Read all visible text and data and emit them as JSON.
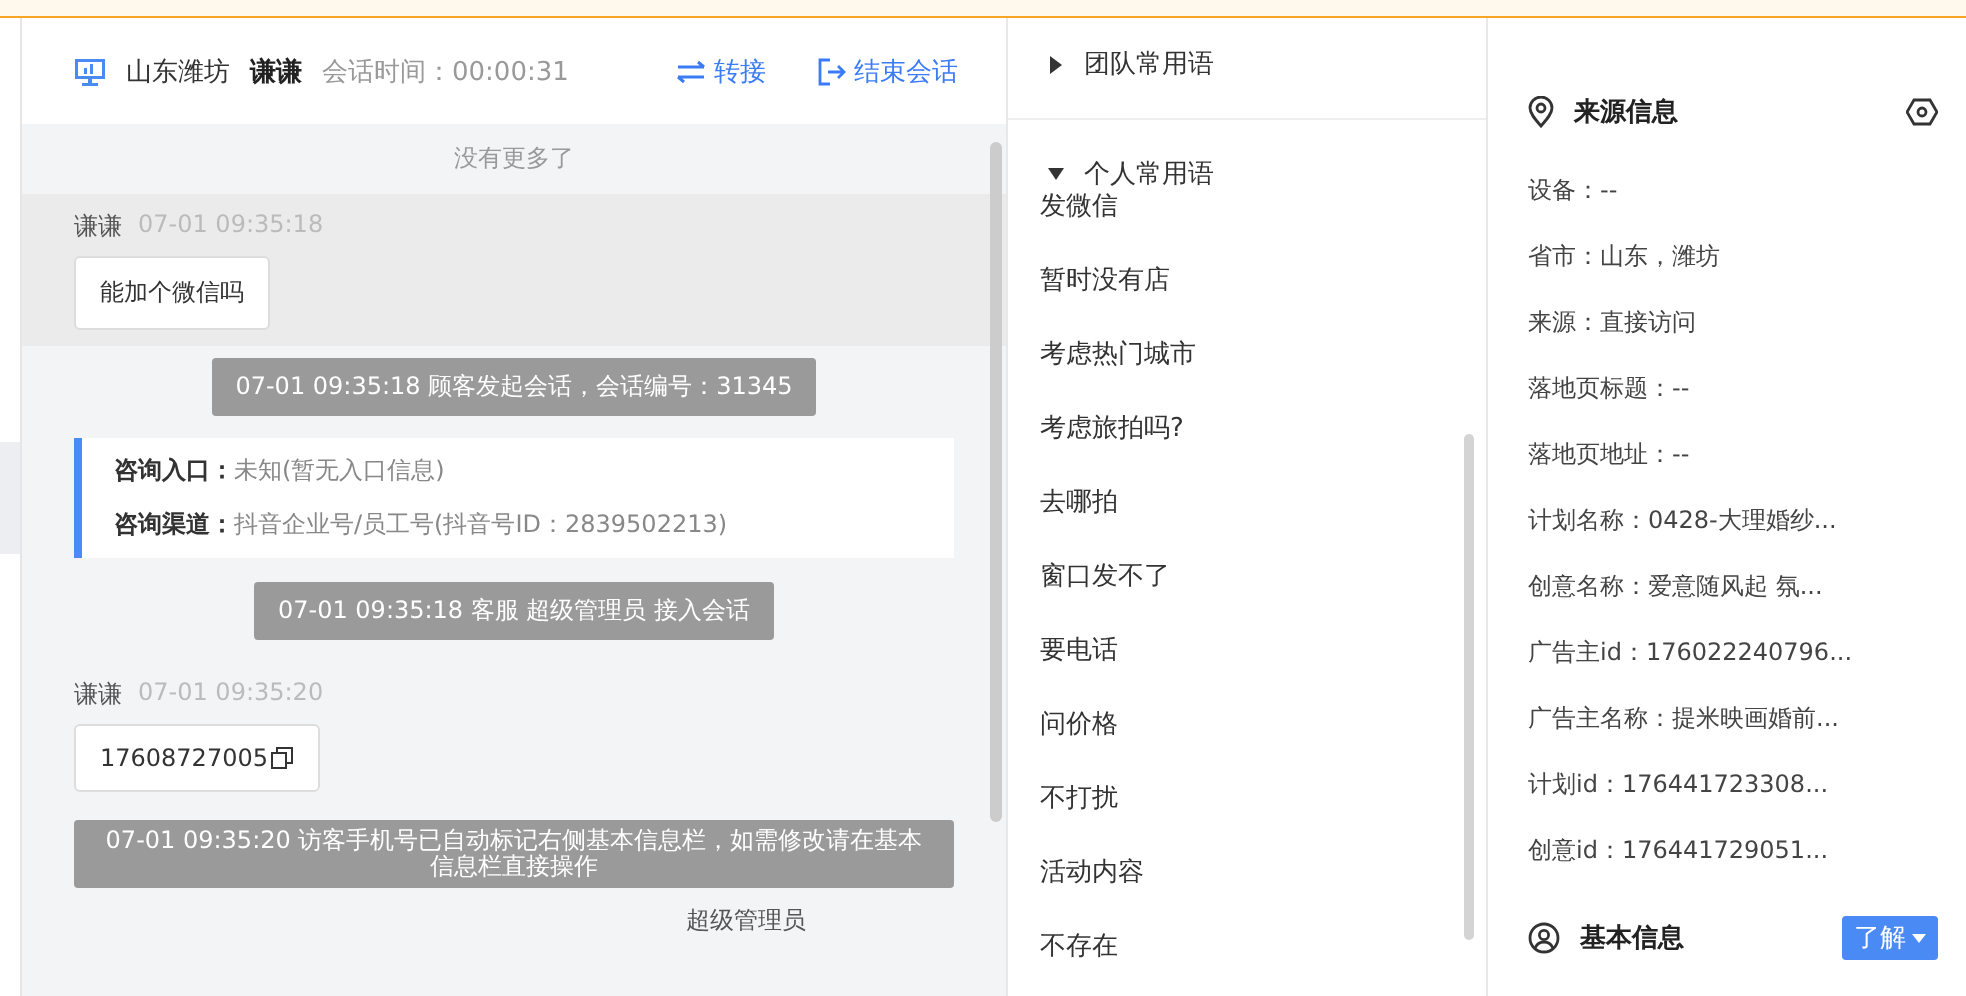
{
  "header": {
    "location": "山东潍坊",
    "visitor": "谦谦",
    "duration_label": "会话时间：",
    "duration": "00:00:31",
    "transfer": "转接",
    "end": "结束会话"
  },
  "chat": {
    "no_more": "没有更多了",
    "messages": [
      {
        "kind": "visitor",
        "name": "谦谦",
        "time": "07-01 09:35:18",
        "text": "能加个微信吗",
        "highlighted": true,
        "copyable": false
      },
      {
        "kind": "notice",
        "text": "07-01 09:35:18 顾客发起会话，会话编号：31345"
      },
      {
        "kind": "info",
        "rows": [
          {
            "label": "咨询入口：",
            "value": "未知(暂无入口信息)"
          },
          {
            "label": "咨询渠道：",
            "value": "抖音企业号/员工号(抖音号ID：2839502213)"
          }
        ]
      },
      {
        "kind": "notice",
        "text": "07-01 09:35:18 客服 超级管理员 接入会话"
      },
      {
        "kind": "visitor",
        "name": "谦谦",
        "time": "07-01 09:35:20",
        "text": "17608727005",
        "highlighted": false,
        "copyable": true
      },
      {
        "kind": "wide-notice",
        "text": "07-01 09:35:20 访客手机号已自动标记右侧基本信息栏，如需修改请在基本信息栏直接操作"
      },
      {
        "kind": "agent",
        "name": "超级管理员"
      }
    ]
  },
  "phrases": {
    "groups": [
      {
        "label": "团队常用语",
        "expanded": false
      },
      {
        "label": "个人常用语",
        "expanded": true,
        "items": [
          "发微信",
          "暂时没有店",
          "考虑热门城市",
          "考虑旅拍吗?",
          "去哪拍",
          "窗口发不了",
          "要电话",
          "问价格",
          "不打扰",
          "活动内容",
          "不存在"
        ]
      }
    ]
  },
  "source": {
    "title": "来源信息",
    "fields": [
      "设备：--",
      "省市：山东，潍坊",
      "来源：直接访问",
      "落地页标题：--",
      "落地页地址：--",
      "计划名称：0428-大理婚纱...",
      "创意名称：爱意随风起 氛...",
      "广告主id：176022240796...",
      "广告主名称：提米映画婚前...",
      "计划id：176441723308...",
      "创意id：176441729051..."
    ]
  },
  "basic": {
    "title": "基本信息",
    "button": "了解"
  }
}
